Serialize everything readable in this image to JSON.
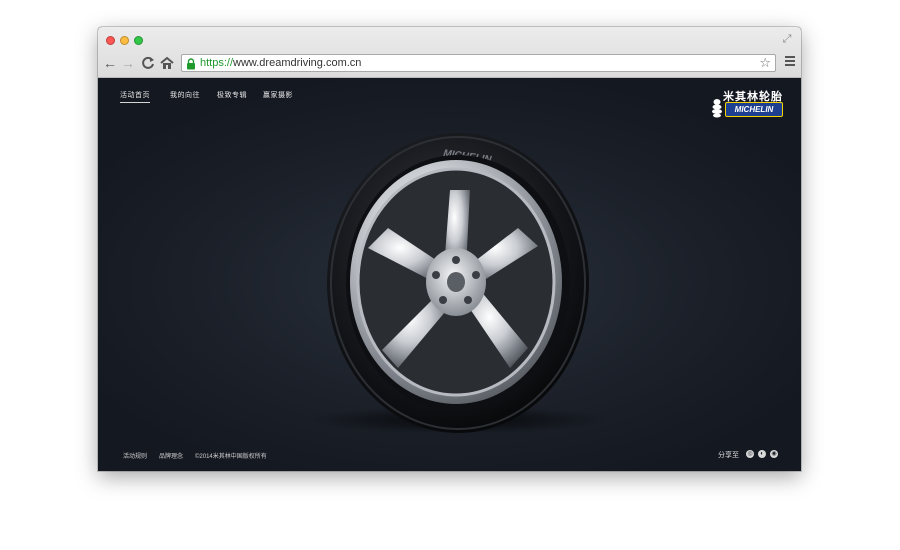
{
  "browser": {
    "url_scheme": "https://",
    "url_rest": "www.dreamdriving.com.cn",
    "back_glyph": "←",
    "forward_glyph": "→",
    "reload_glyph": "C",
    "home_glyph": "⌂",
    "star_glyph": "☆",
    "resize_glyph": "⤢",
    "icons": [
      "back-arrow-icon",
      "forward-arrow-icon",
      "reload-icon",
      "home-icon",
      "lock-icon",
      "star-icon",
      "menu-icon",
      "fullscreen-icon"
    ],
    "lock_color": "#1e9a2d"
  },
  "nav": {
    "items": [
      {
        "label": "活动首页",
        "active": true
      },
      {
        "label": "我的向往",
        "active": false
      },
      {
        "label": "极致专辑",
        "active": false
      },
      {
        "label": "赢家摄影",
        "active": false
      }
    ]
  },
  "logo": {
    "cn_text": "米其林轮胎",
    "brand_text": "MICHELIN",
    "colors": {
      "box": "#1d3f8f",
      "border": "#f6d200"
    }
  },
  "hero": {
    "tire_sidewall_text": "MICHELIN",
    "icon": "wheel-tire-image"
  },
  "footer": {
    "items": [
      "活动规则",
      "品牌理念",
      "©2014米其林中国版权所有"
    ],
    "share_label": "分享至",
    "share_icons": [
      {
        "name": "weibo-share-icon",
        "glyph": "◎"
      },
      {
        "name": "tencent-weibo-share-icon",
        "glyph": "◐"
      },
      {
        "name": "renren-share-icon",
        "glyph": "◉"
      }
    ]
  }
}
